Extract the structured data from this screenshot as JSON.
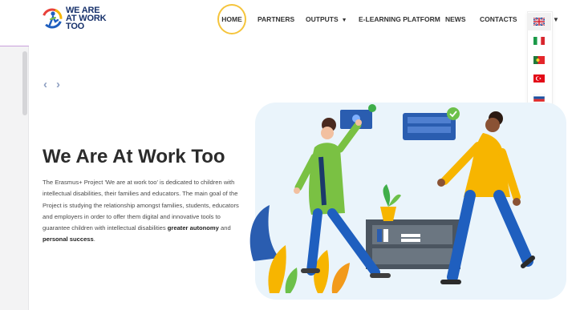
{
  "logo": {
    "line1": "WE ARE",
    "line2": "AT WORK",
    "line3": "TOO"
  },
  "nav": {
    "items": [
      {
        "label": "HOME"
      },
      {
        "label": "PARTNERS"
      },
      {
        "label": "OUTPUTS"
      },
      {
        "label": "E-LEARNING PLATFORM"
      },
      {
        "label": "NEWS"
      },
      {
        "label": "CONTACTS"
      }
    ],
    "outputs_caret": "▼"
  },
  "languages": {
    "current": "gb-flag-icon",
    "options": [
      "it-flag-icon",
      "pt-flag-icon",
      "tr-flag-icon",
      "si-flag-icon",
      "pl-flag-icon",
      "ro-flag-icon"
    ],
    "caret": "▼"
  },
  "slider": {
    "prev": "‹",
    "next": "›"
  },
  "hero": {
    "title": "We Are At Work Too",
    "desc_intro": "The Erasmus+ Project 'We are at work too' is dedicated to children with intellectual disabilities, their families and educators. The main goal of the Project is studying the relationship amongst families, students, educators and employers in order to offer them digital and innovative tools to guarantee children with intellectual disabilities ",
    "desc_bold1": "greater autonomy",
    "desc_and": " and ",
    "desc_bold2": "personal success",
    "desc_end": "."
  },
  "colors": {
    "brand_blue": "#17316b",
    "home_ring": "#f5c43b",
    "illustration_bg": "#eaf4fb",
    "green_coat": "#7ac143",
    "yellow_jacket": "#f7b500",
    "blue_pants": "#1f5fbf"
  }
}
